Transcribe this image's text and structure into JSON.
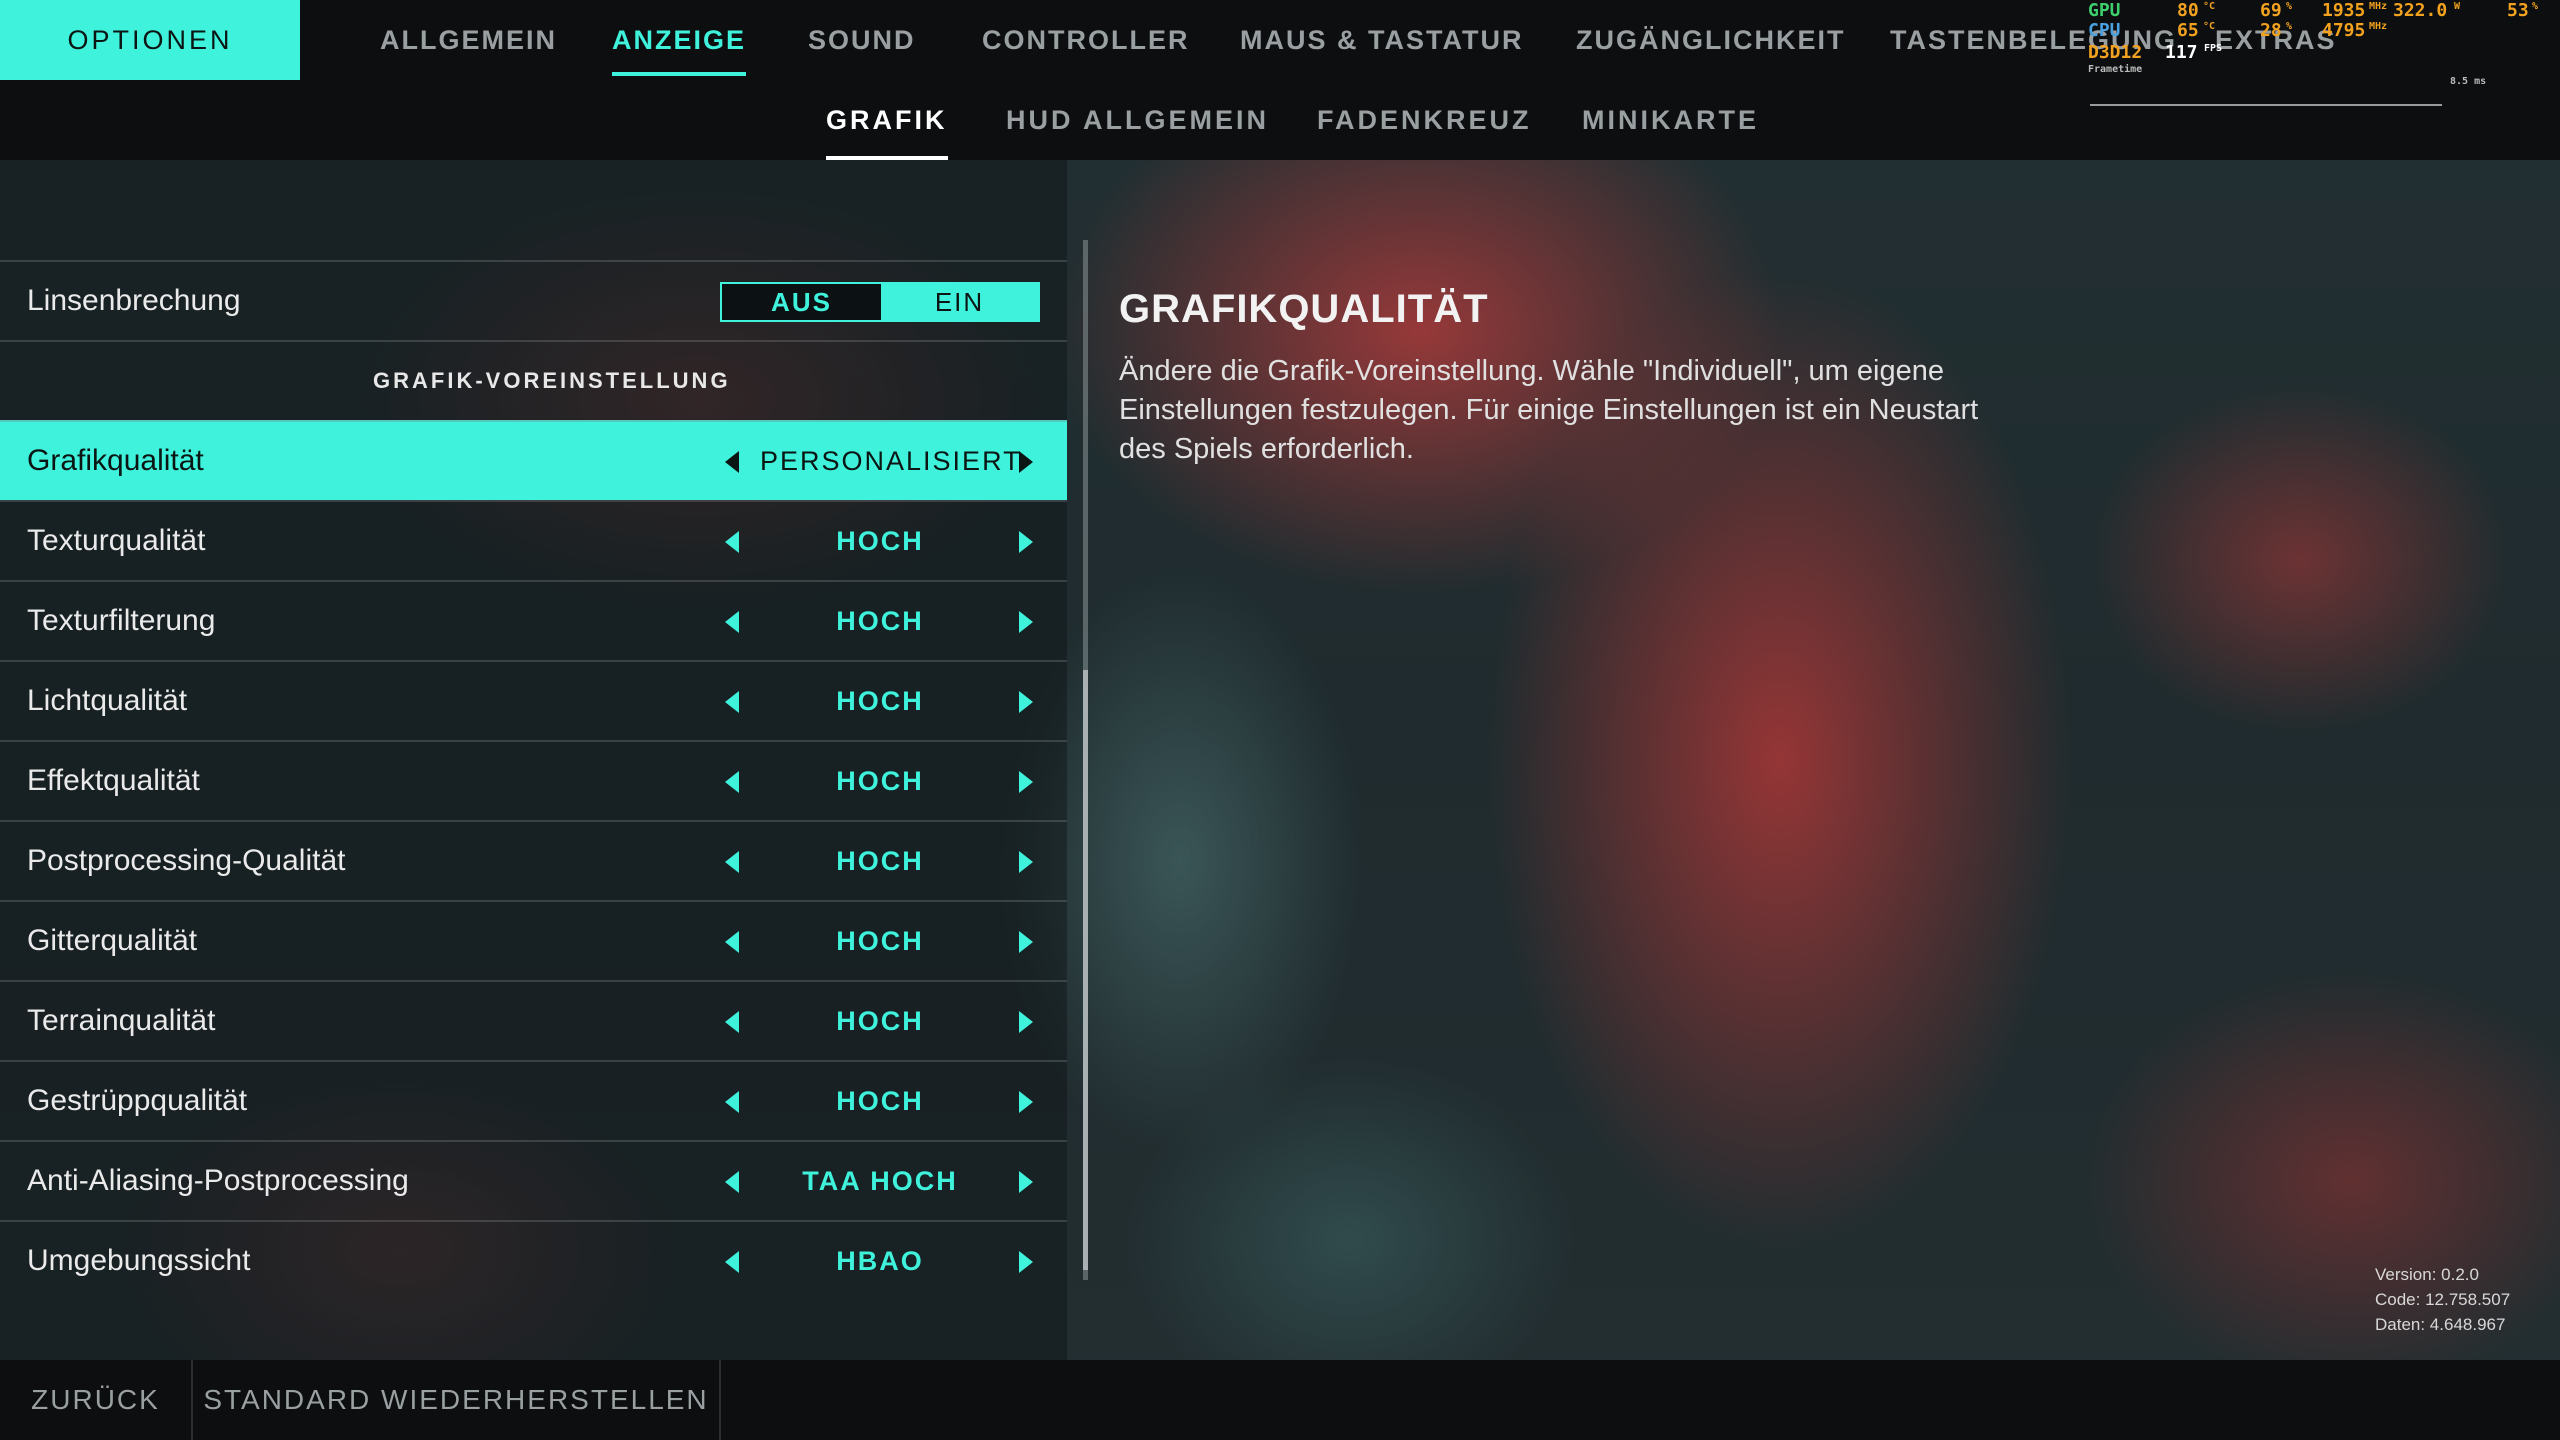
{
  "colors": {
    "accent": "#3ff2dc",
    "panel_dark": "#0c0e0f",
    "text_dim": "#9aa0a2"
  },
  "header": {
    "options_label": "OPTIONEN"
  },
  "nav": {
    "tabs": [
      {
        "label": "ALLGEMEIN"
      },
      {
        "label": "ANZEIGE"
      },
      {
        "label": "SOUND"
      },
      {
        "label": "CONTROLLER"
      },
      {
        "label": "MAUS & TASTATUR"
      },
      {
        "label": "ZUGÄNGLICHKEIT"
      },
      {
        "label": "TASTENBELEGUNG"
      },
      {
        "label": "EXTRAS"
      }
    ],
    "active": "ANZEIGE"
  },
  "subnav": {
    "tabs": [
      {
        "label": "GRAFIK"
      },
      {
        "label": "HUD ALLGEMEIN"
      },
      {
        "label": "FADENKREUZ"
      },
      {
        "label": "MINIKARTE"
      }
    ],
    "active": "GRAFIK"
  },
  "hw_overlay": {
    "gpu_label": "GPU",
    "gpu_temp": "80",
    "gpu_temp_unit": "°C",
    "gpu_load": "69",
    "gpu_load_unit": "%",
    "gpu_clock": "1935",
    "gpu_clock_unit": "MHz",
    "gpu_power": "322.0",
    "gpu_power_unit": "W",
    "gpu_mem": "53",
    "gpu_mem_unit": "%",
    "cpu_label": "CPU",
    "cpu_temp": "65",
    "cpu_temp_unit": "°C",
    "cpu_load": "28",
    "cpu_load_unit": "%",
    "cpu_clock": "4795",
    "cpu_clock_unit": "MHz",
    "api": "D3D12",
    "fps": "117",
    "fps_unit": "FPS",
    "frametime_label": "Frametime",
    "frametime_scale": "8.5 ms"
  },
  "settings": {
    "lens_distortion": {
      "label": "Linsenbrechung",
      "off": "AUS",
      "on": "EIN",
      "selected": "AUS"
    },
    "section_title": "GRAFIK-VOREINSTELLUNG",
    "rows": [
      {
        "label": "Grafikqualität",
        "value": "PERSONALISIERT"
      },
      {
        "label": "Texturqualität",
        "value": "HOCH"
      },
      {
        "label": "Texturfilterung",
        "value": "HOCH"
      },
      {
        "label": "Lichtqualität",
        "value": "HOCH"
      },
      {
        "label": "Effektqualität",
        "value": "HOCH"
      },
      {
        "label": "Postprocessing-Qualität",
        "value": "HOCH"
      },
      {
        "label": "Gitterqualität",
        "value": "HOCH"
      },
      {
        "label": "Terrainqualität",
        "value": "HOCH"
      },
      {
        "label": "Gestrüppqualität",
        "value": "HOCH"
      },
      {
        "label": "Anti-Aliasing-Postprocessing",
        "value": "TAA HOCH"
      },
      {
        "label": "Umgebungssicht",
        "value": "HBAO"
      }
    ],
    "selected_row": "Grafikqualität"
  },
  "description": {
    "title": "GRAFIKQUALITÄT",
    "body": "Ändere die Grafik-Voreinstellung. Wähle \"Individuell\", um eigene Einstellungen festzulegen. Für einige Einstellungen ist ein Neustart des Spiels erforderlich."
  },
  "version_info": {
    "version": "Version: 0.2.0",
    "code": "Code: 12.758.507",
    "data": "Daten: 4.648.967"
  },
  "footer": {
    "back_label": "ZURÜCK",
    "reset_label": "STANDARD WIEDERHERSTELLEN"
  },
  "icons": {
    "prev": "triangle-left-icon",
    "next": "triangle-right-icon"
  }
}
